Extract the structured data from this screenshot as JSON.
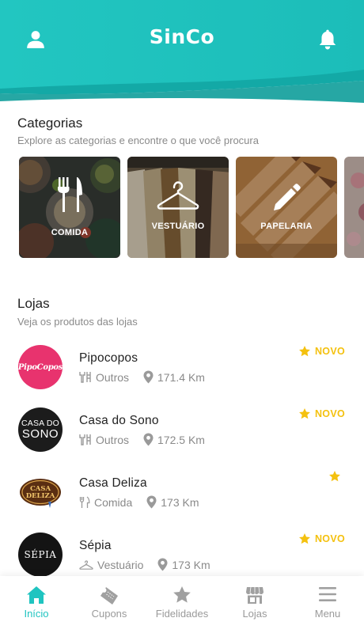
{
  "colors": {
    "accent": "#1fc4c0",
    "accent_dark": "#12a6a3",
    "star": "#f4c10f",
    "muted": "#8a8a8a"
  },
  "header": {
    "title": "SinCo",
    "left_icon": "user-icon",
    "right_icon": "bell-icon"
  },
  "categories_section": {
    "title": "Categorias",
    "subtitle": "Explore as categorias e encontre o que você procura",
    "items": [
      {
        "label": "COMIDA",
        "icon": "utensils-icon"
      },
      {
        "label": "VESTUÁRIO",
        "icon": "hanger-icon"
      },
      {
        "label": "PAPELARIA",
        "icon": "pencil-icon"
      }
    ]
  },
  "stores_section": {
    "title": "Lojas",
    "subtitle": "Veja os produtos das lojas",
    "items": [
      {
        "name": "Pipocopos",
        "category": "Outros",
        "category_icon": "tools-icon",
        "distance": "171.4 Km",
        "badge": "NOVO",
        "logo_text": "PipoCopos"
      },
      {
        "name": "Casa do Sono",
        "category": "Outros",
        "category_icon": "tools-icon",
        "distance": "172.5 Km",
        "badge": "NOVO",
        "logo_text_1": "CASA DO",
        "logo_text_2": "SONO"
      },
      {
        "name": "Casa Deliza",
        "category": "Comida",
        "category_icon": "utensils-icon",
        "distance": "173 Km",
        "badge": "",
        "logo_text_1": "CASA",
        "logo_text_2": "DELIZA"
      },
      {
        "name": "Sépia",
        "category": "Vestuário",
        "category_icon": "hanger-icon",
        "distance": "173 Km",
        "badge": "NOVO",
        "logo_text": "SÉPIA"
      }
    ]
  },
  "bottom_nav": {
    "items": [
      {
        "label": "Início",
        "icon": "home-icon",
        "active": true
      },
      {
        "label": "Cupons",
        "icon": "ticket-icon",
        "active": false
      },
      {
        "label": "Fidelidades",
        "icon": "star-icon",
        "active": false
      },
      {
        "label": "Lojas",
        "icon": "store-icon",
        "active": false
      },
      {
        "label": "Menu",
        "icon": "menu-icon",
        "active": false
      }
    ]
  }
}
